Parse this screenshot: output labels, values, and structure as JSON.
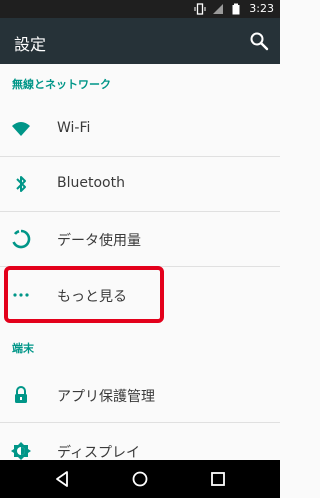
{
  "status_bar": {
    "time": "3:23"
  },
  "app_bar": {
    "title": "設定"
  },
  "sections": [
    {
      "header": "無線とネットワーク"
    },
    {
      "header": "端末"
    }
  ],
  "items": [
    {
      "label": "Wi-Fi",
      "icon": "wifi-icon"
    },
    {
      "label": "Bluetooth",
      "icon": "bluetooth-icon"
    },
    {
      "label": "データ使用量",
      "icon": "data-usage-icon"
    },
    {
      "label": "もっと見る",
      "icon": "more-dots-icon"
    },
    {
      "label": "アプリ保護管理",
      "icon": "lock-icon"
    },
    {
      "label": "ディスプレイ",
      "icon": "brightness-icon"
    }
  ],
  "colors": {
    "accent": "#009688",
    "app_bar": "#263238",
    "highlight": "#e3001b"
  }
}
